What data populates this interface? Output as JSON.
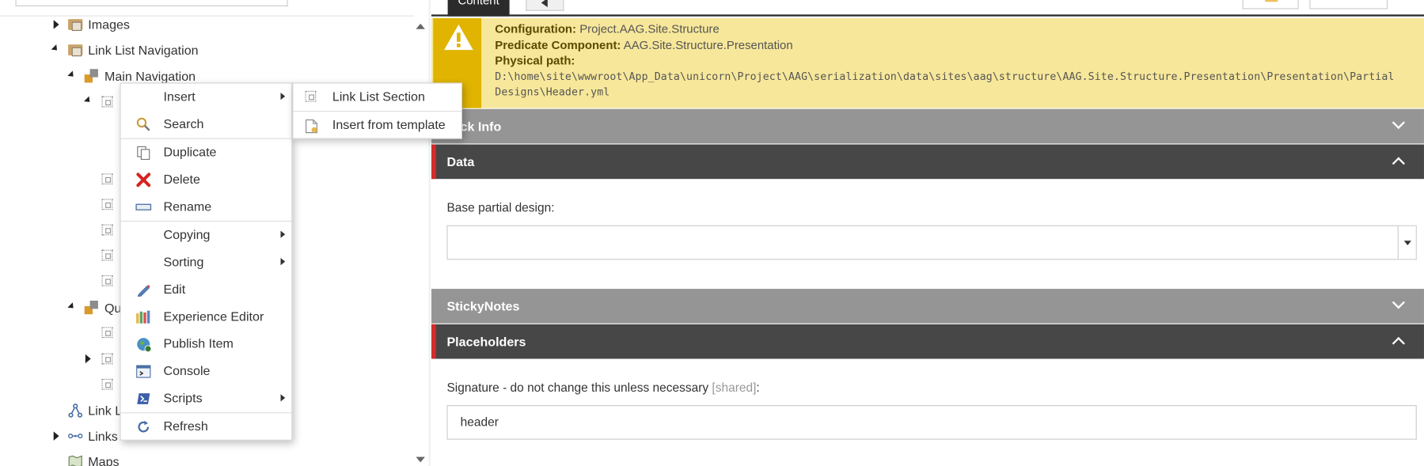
{
  "tree": {
    "items": [
      {
        "label": "Images"
      },
      {
        "label": "Link List Navigation"
      },
      {
        "label": "Main Navigation"
      },
      {
        "label": "Qu"
      },
      {
        "label": "Link L"
      },
      {
        "label": "Links"
      },
      {
        "label": "Maps"
      }
    ]
  },
  "tabs": {
    "content_label": "Content"
  },
  "warning": {
    "config_label": "Configuration",
    "config_value": "Project.AAG.Site.Structure",
    "predicate_label": "Predicate Component",
    "predicate_value": "AAG.Site.Structure.Presentation",
    "path_label": "Physical path",
    "path_value": "D:\\home\\site\\wwwroot\\App_Data\\unicorn\\Project\\AAG\\serialization\\data\\sites\\aag\\structure\\AAG.Site.Structure.Presentation\\Presentation\\Partial Designs\\Header.yml"
  },
  "sections": {
    "quick_info": "ick Info",
    "data": "Data",
    "stickynotes": "StickyNotes",
    "placeholders": "Placeholders"
  },
  "fields": {
    "base_partial_label": "Base partial design:",
    "base_partial_value": "",
    "signature_label": "Signature - do not change this unless necessary",
    "signature_shared": "[shared]",
    "signature_colon": ":",
    "signature_value": "header"
  },
  "context_menu": {
    "items": [
      {
        "label": "Insert",
        "icon": "none",
        "submenu": true
      },
      {
        "label": "Search",
        "icon": "search-icon"
      },
      {
        "label": "Duplicate",
        "icon": "duplicate-icon"
      },
      {
        "label": "Delete",
        "icon": "delete-icon"
      },
      {
        "label": "Rename",
        "icon": "rename-icon"
      },
      {
        "label": "Copying",
        "icon": "none",
        "submenu": true
      },
      {
        "label": "Sorting",
        "icon": "none",
        "submenu": true
      },
      {
        "label": "Edit",
        "icon": "edit-icon"
      },
      {
        "label": "Experience Editor",
        "icon": "experience-editor-icon"
      },
      {
        "label": "Publish Item",
        "icon": "publish-icon"
      },
      {
        "label": "Console",
        "icon": "console-icon"
      },
      {
        "label": "Scripts",
        "icon": "scripts-icon",
        "submenu": true
      },
      {
        "label": "Refresh",
        "icon": "refresh-icon"
      }
    ]
  },
  "insert_submenu": {
    "items": [
      {
        "label": "Link List Section",
        "icon": "section-icon"
      },
      {
        "label": "Insert from template",
        "icon": "template-icon"
      }
    ]
  },
  "colors": {
    "warning_bg": "#f7e79a",
    "warning_accent": "#e0b400",
    "section_dark": "#474747",
    "section_light": "#959595",
    "accent_red": "#d62b2b"
  }
}
